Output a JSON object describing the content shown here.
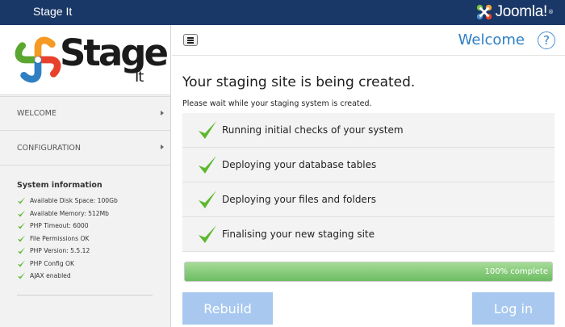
{
  "app": {
    "title": "Stage It",
    "brand": "Joomla!",
    "brand_tm": "®"
  },
  "logo": {
    "stage": "Stage",
    "it": "It"
  },
  "sidebar": {
    "nav": [
      {
        "label": "WELCOME"
      },
      {
        "label": "CONFIGURATION"
      }
    ],
    "sysinfo_title": "System information",
    "sysinfo": [
      "Available Disk Space: 100Gb",
      "Available Memory: 512Mb",
      "PHP Timeout: 6000",
      "File Permissions OK",
      "PHP Version: 5.5.12",
      "PHP Config OK",
      "AJAX enabled"
    ]
  },
  "header": {
    "title": "Welcome",
    "help": "?"
  },
  "main": {
    "heading": "Your staging site is being created.",
    "subheading": "Please wait while your staging system is created.",
    "steps": [
      "Running initial checks of your system",
      "Deploying your database tables",
      "Deploying your files and folders",
      "Finalising your new staging site"
    ],
    "progress": {
      "fraction": 1.0,
      "label": "100% complete"
    },
    "buttons": {
      "rebuild": "Rebuild",
      "login": "Log in"
    }
  },
  "colors": {
    "topbar": "#1a3867",
    "accent": "#2d7fc4",
    "check": "#5cb82e",
    "button": "#a8c8ef",
    "progress": "#6cbc62"
  },
  "icons": {
    "check": "check-icon",
    "help": "help-icon",
    "menu": "menu-icon",
    "joomla": "joomla-logo-icon"
  }
}
